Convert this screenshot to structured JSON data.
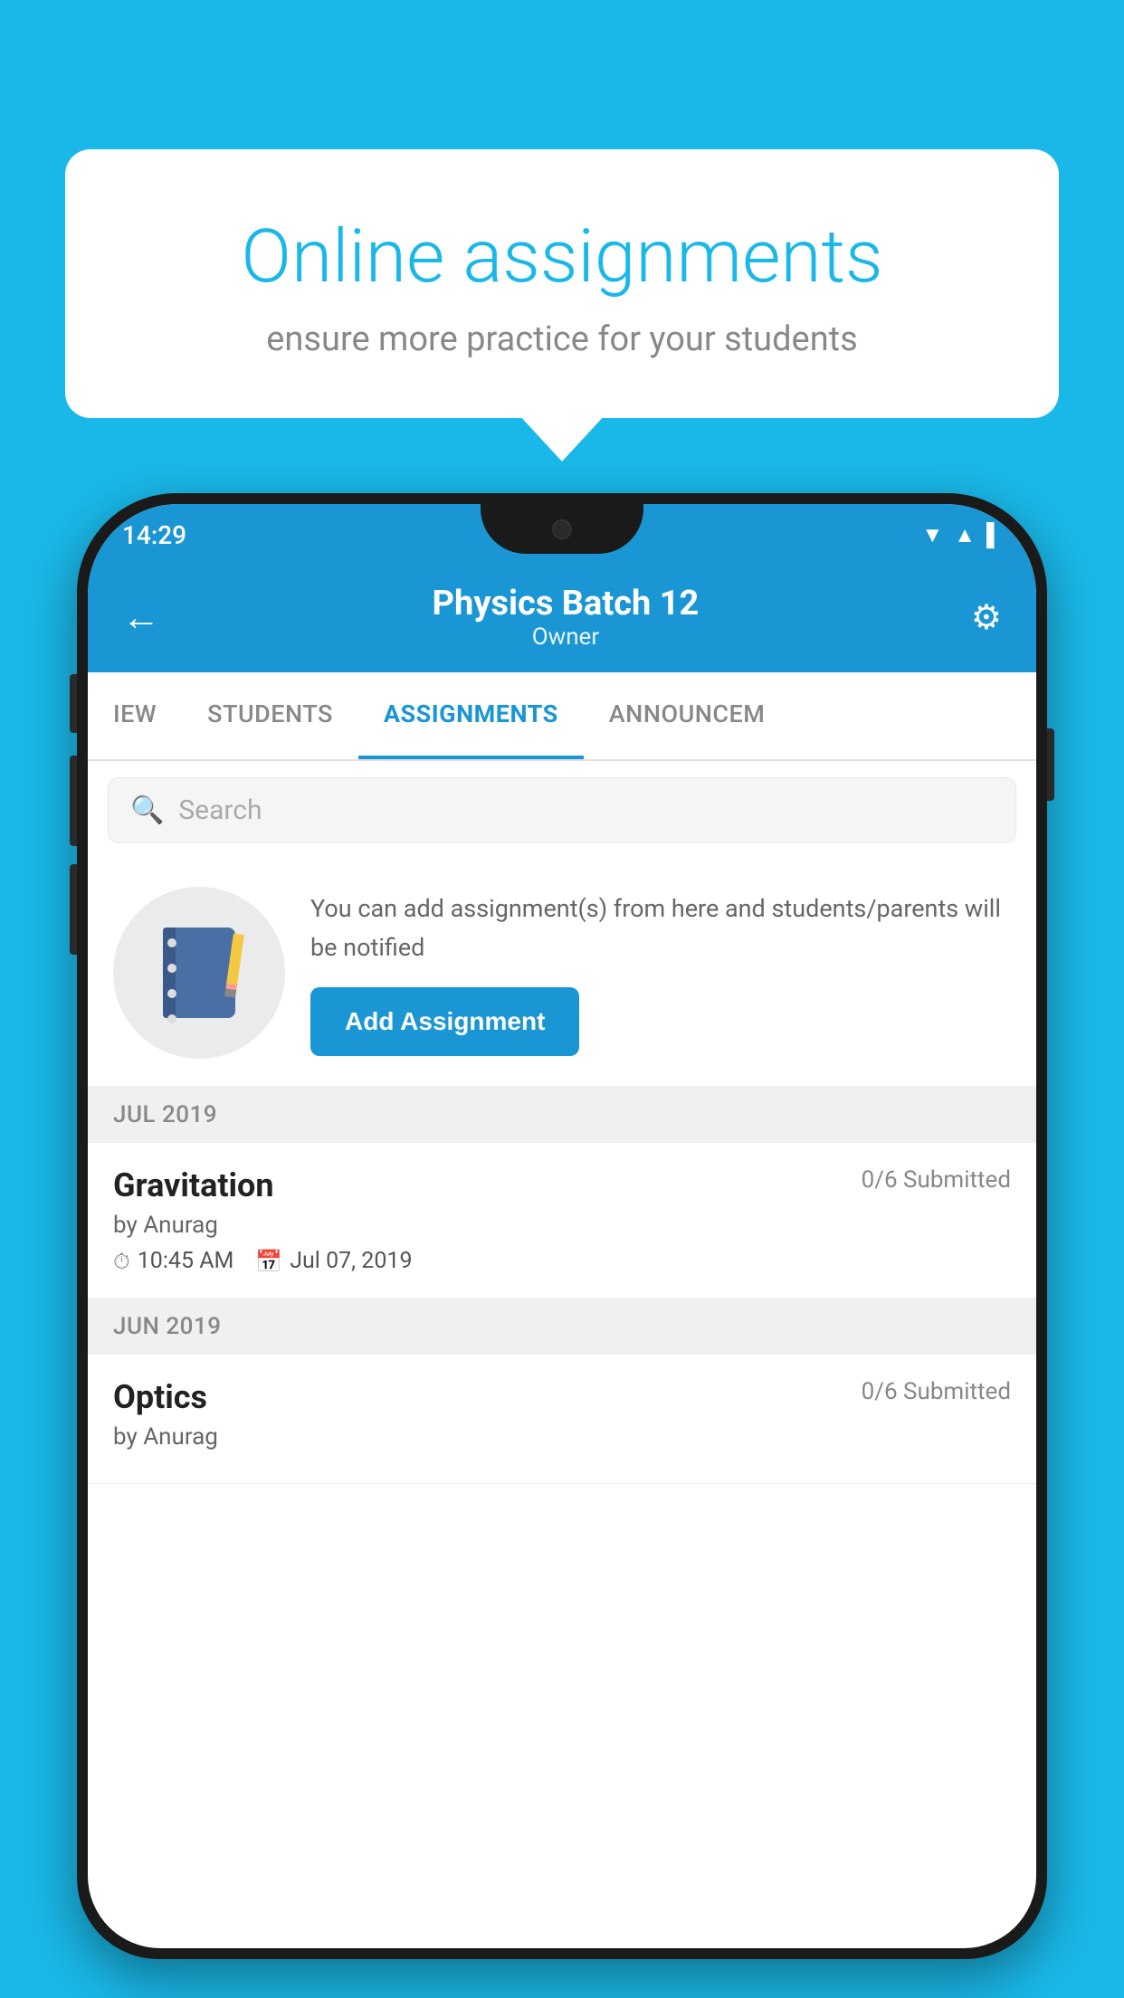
{
  "bubble": {
    "title": "Online assignments",
    "subtitle": "ensure more practice for your students"
  },
  "phone": {
    "status": {
      "time": "14:29",
      "icons": "▼ ▲ ▌"
    },
    "header": {
      "title": "Physics Batch 12",
      "subtitle": "Owner",
      "back_label": "←",
      "settings_label": "⚙"
    },
    "tabs": [
      {
        "label": "IEW",
        "active": false
      },
      {
        "label": "STUDENTS",
        "active": false
      },
      {
        "label": "ASSIGNMENTS",
        "active": true
      },
      {
        "label": "ANNOUNCEM",
        "active": false
      }
    ],
    "search": {
      "placeholder": "Search"
    },
    "promo": {
      "text": "You can add assignment(s) from here and students/parents will be notified",
      "button_label": "Add Assignment"
    },
    "sections": [
      {
        "label": "JUL 2019",
        "assignments": [
          {
            "name": "Gravitation",
            "submitted": "0/6 Submitted",
            "by": "by Anurag",
            "time": "10:45 AM",
            "date": "Jul 07, 2019"
          }
        ]
      },
      {
        "label": "JUN 2019",
        "assignments": [
          {
            "name": "Optics",
            "submitted": "0/6 Submitted",
            "by": "by Anurag",
            "time": "",
            "date": ""
          }
        ]
      }
    ]
  }
}
